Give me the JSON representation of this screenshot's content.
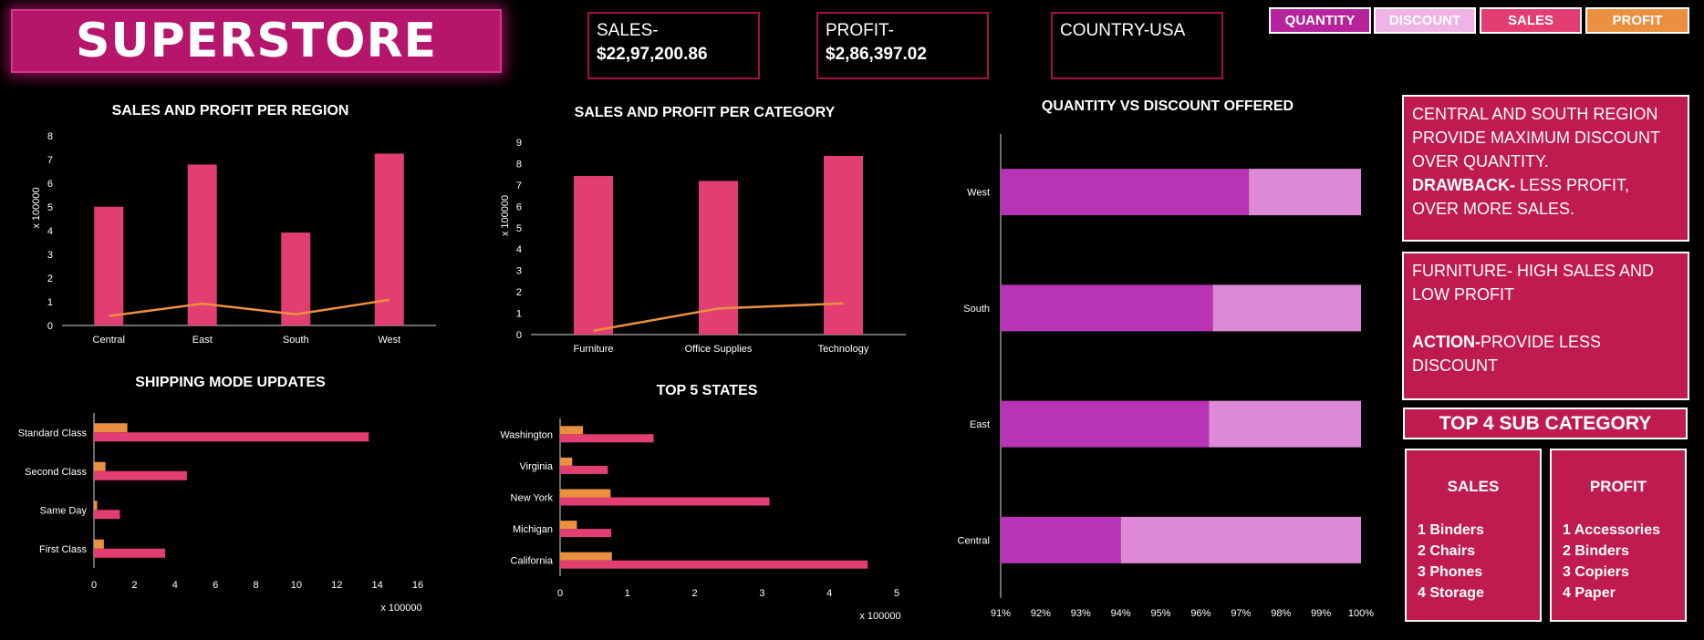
{
  "header": {
    "title": "SUPERSTORE",
    "kpis": [
      {
        "label": "SALES-",
        "value": "$22,97,200.86"
      },
      {
        "label": "PROFIT-",
        "value": "$2,86,397.02"
      },
      {
        "label": "COUNTRY-USA",
        "value": ""
      }
    ]
  },
  "legend": {
    "items": [
      {
        "label": "QUANTITY",
        "color": "#b5249c"
      },
      {
        "label": "DISCOUNT",
        "color": "#f0b3e8"
      },
      {
        "label": "SALES",
        "color": "#e23e71"
      },
      {
        "label": "PROFIT",
        "color": "#eb9040"
      }
    ]
  },
  "colors": {
    "sales": "#e23e71",
    "profit": "#eb9040",
    "quantity": "#b934b4",
    "discount": "#dc8ad8",
    "panel": "#c01b4e"
  },
  "chart_data": [
    {
      "type": "bar",
      "title": "SALES AND PROFIT PER REGION",
      "categories": [
        "Central",
        "East",
        "South",
        "West"
      ],
      "series": [
        {
          "name": "SALES",
          "type": "bar",
          "values": [
            5.01,
            6.79,
            3.92,
            7.25
          ]
        },
        {
          "name": "PROFIT",
          "type": "line",
          "values": [
            0.4,
            0.92,
            0.47,
            1.08
          ]
        }
      ],
      "ylabel": "x 100000",
      "ylim": [
        0,
        8
      ],
      "yticks": [
        0,
        1,
        2,
        3,
        4,
        5,
        6,
        7,
        8
      ]
    },
    {
      "type": "bar",
      "title": "SALES AND PROFIT PER CATEGORY",
      "categories": [
        "Furniture",
        "Office Supplies",
        "Technology"
      ],
      "series": [
        {
          "name": "SALES",
          "type": "bar",
          "values": [
            7.42,
            7.19,
            8.36
          ]
        },
        {
          "name": "PROFIT",
          "type": "line",
          "values": [
            0.18,
            1.22,
            1.46
          ]
        }
      ],
      "ylabel": "x 100000",
      "ylim": [
        0,
        9
      ],
      "yticks": [
        0,
        1,
        2,
        3,
        4,
        5,
        6,
        7,
        8,
        9
      ]
    },
    {
      "type": "bar",
      "orientation": "horizontal",
      "title": "SHIPPING MODE UPDATES",
      "categories": [
        "Standard Class",
        "Second Class",
        "Same Day",
        "First Class"
      ],
      "series": [
        {
          "name": "PROFIT",
          "values": [
            1.65,
            0.57,
            0.16,
            0.49
          ]
        },
        {
          "name": "SALES",
          "values": [
            13.58,
            4.59,
            1.28,
            3.52
          ]
        }
      ],
      "xlabel": "x 100000",
      "xlim": [
        0,
        16
      ],
      "xticks": [
        0,
        2,
        4,
        6,
        8,
        10,
        12,
        14,
        16
      ]
    },
    {
      "type": "bar",
      "orientation": "horizontal",
      "title": "TOP 5 STATES",
      "categories": [
        "Washington",
        "Virginia",
        "New York",
        "Michigan",
        "California"
      ],
      "series": [
        {
          "name": "PROFIT",
          "values": [
            0.34,
            0.18,
            0.75,
            0.25,
            0.77
          ]
        },
        {
          "name": "SALES",
          "values": [
            1.39,
            0.71,
            3.11,
            0.76,
            4.57
          ]
        }
      ],
      "xlabel": "x 100000",
      "xlim": [
        0,
        5
      ],
      "xticks": [
        0,
        1,
        2,
        3,
        4,
        5
      ]
    },
    {
      "type": "bar",
      "orientation": "horizontal",
      "stacked": true,
      "title": "QUANTITY VS DISCOUNT OFFERED",
      "categories": [
        "West",
        "South",
        "East",
        "Central"
      ],
      "series": [
        {
          "name": "QUANTITY",
          "values": [
            97.2,
            96.3,
            96.2,
            94.0
          ]
        },
        {
          "name": "DISCOUNT",
          "values": [
            2.8,
            3.7,
            3.8,
            6.0
          ]
        }
      ],
      "xlim": [
        91,
        100
      ],
      "xticks": [
        "91%",
        "92%",
        "93%",
        "94%",
        "95%",
        "96%",
        "97%",
        "98%",
        "99%",
        "100%"
      ]
    }
  ],
  "insights": {
    "panel1": {
      "line1": "CENTRAL AND SOUTH REGION PROVIDE MAXIMUM DISCOUNT OVER QUANTITY.",
      "bold": "DRAWBACK-",
      "line2": " LESS PROFIT, OVER MORE SALES."
    },
    "panel2": {
      "line1": "FURNITURE- HIGH SALES AND LOW PROFIT",
      "bold": "ACTION-",
      "line2": "PROVIDE LESS DISCOUNT"
    }
  },
  "top4": {
    "title": "TOP 4 SUB CATEGORY",
    "sales": {
      "heading": "SALES",
      "items": [
        "1 Binders",
        "2 Chairs",
        "3 Phones",
        "4 Storage"
      ]
    },
    "profit": {
      "heading": "PROFIT",
      "items": [
        "1 Accessories",
        "2 Binders",
        "3 Copiers",
        "4 Paper"
      ]
    }
  }
}
